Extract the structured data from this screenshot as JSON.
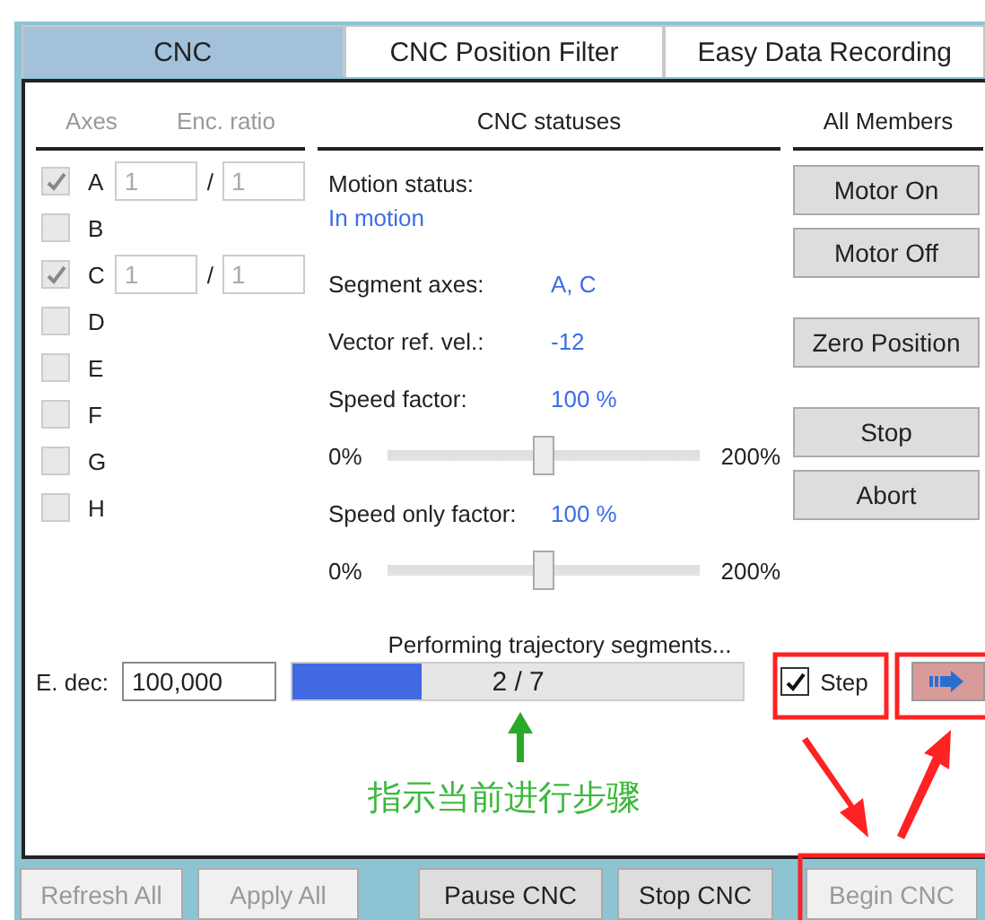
{
  "tabs": [
    {
      "label": "CNC",
      "selected": true
    },
    {
      "label": "CNC Position Filter",
      "selected": false
    },
    {
      "label": "Easy Data Recording",
      "selected": false
    }
  ],
  "axes_panel": {
    "headers": [
      "Axes",
      "Enc. ratio"
    ],
    "axes": [
      {
        "label": "A",
        "checked": true,
        "ratio": [
          "1",
          "1"
        ]
      },
      {
        "label": "B",
        "checked": false
      },
      {
        "label": "C",
        "checked": true,
        "ratio": [
          "1",
          "1"
        ]
      },
      {
        "label": "D",
        "checked": false
      },
      {
        "label": "E",
        "checked": false
      },
      {
        "label": "F",
        "checked": false
      },
      {
        "label": "G",
        "checked": false
      },
      {
        "label": "H",
        "checked": false
      }
    ],
    "ratio_separator": "/"
  },
  "statuses": {
    "title": "CNC statuses",
    "motion_label": "Motion status:",
    "motion_value": "In motion",
    "fields": [
      {
        "label": "Segment axes:",
        "value": "A, C"
      },
      {
        "label": "Vector ref. vel.:",
        "value": "-12"
      }
    ],
    "sliders": [
      {
        "label": "Speed factor:",
        "value": "100 %",
        "min": "0%",
        "max": "200%",
        "level": 0.5
      },
      {
        "label": "Speed only factor:",
        "value": "100 %",
        "min": "0%",
        "max": "200%",
        "level": 0.5
      }
    ]
  },
  "members": {
    "title": "All Members",
    "button_groups": [
      [
        "Motor On",
        "Motor Off"
      ],
      [
        "Zero Position"
      ],
      [
        "Stop",
        "Abort"
      ]
    ]
  },
  "progress": {
    "caption": "Performing trajectory segments...",
    "e_dec_label": "E. dec:",
    "e_dec_value": "100,000",
    "level": 0.286,
    "text": "2 / 7",
    "step": {
      "label": "Step",
      "checked": true
    }
  },
  "bottom_buttons": [
    {
      "label": "Refresh All",
      "disabled": true
    },
    {
      "label": "Apply All",
      "disabled": true
    },
    {
      "label": "Pause CNC",
      "disabled": false
    },
    {
      "label": "Stop CNC",
      "disabled": false
    },
    {
      "label": "Begin CNC",
      "disabled": true
    }
  ],
  "annotation": {
    "text": "指示当前进行步骤"
  }
}
